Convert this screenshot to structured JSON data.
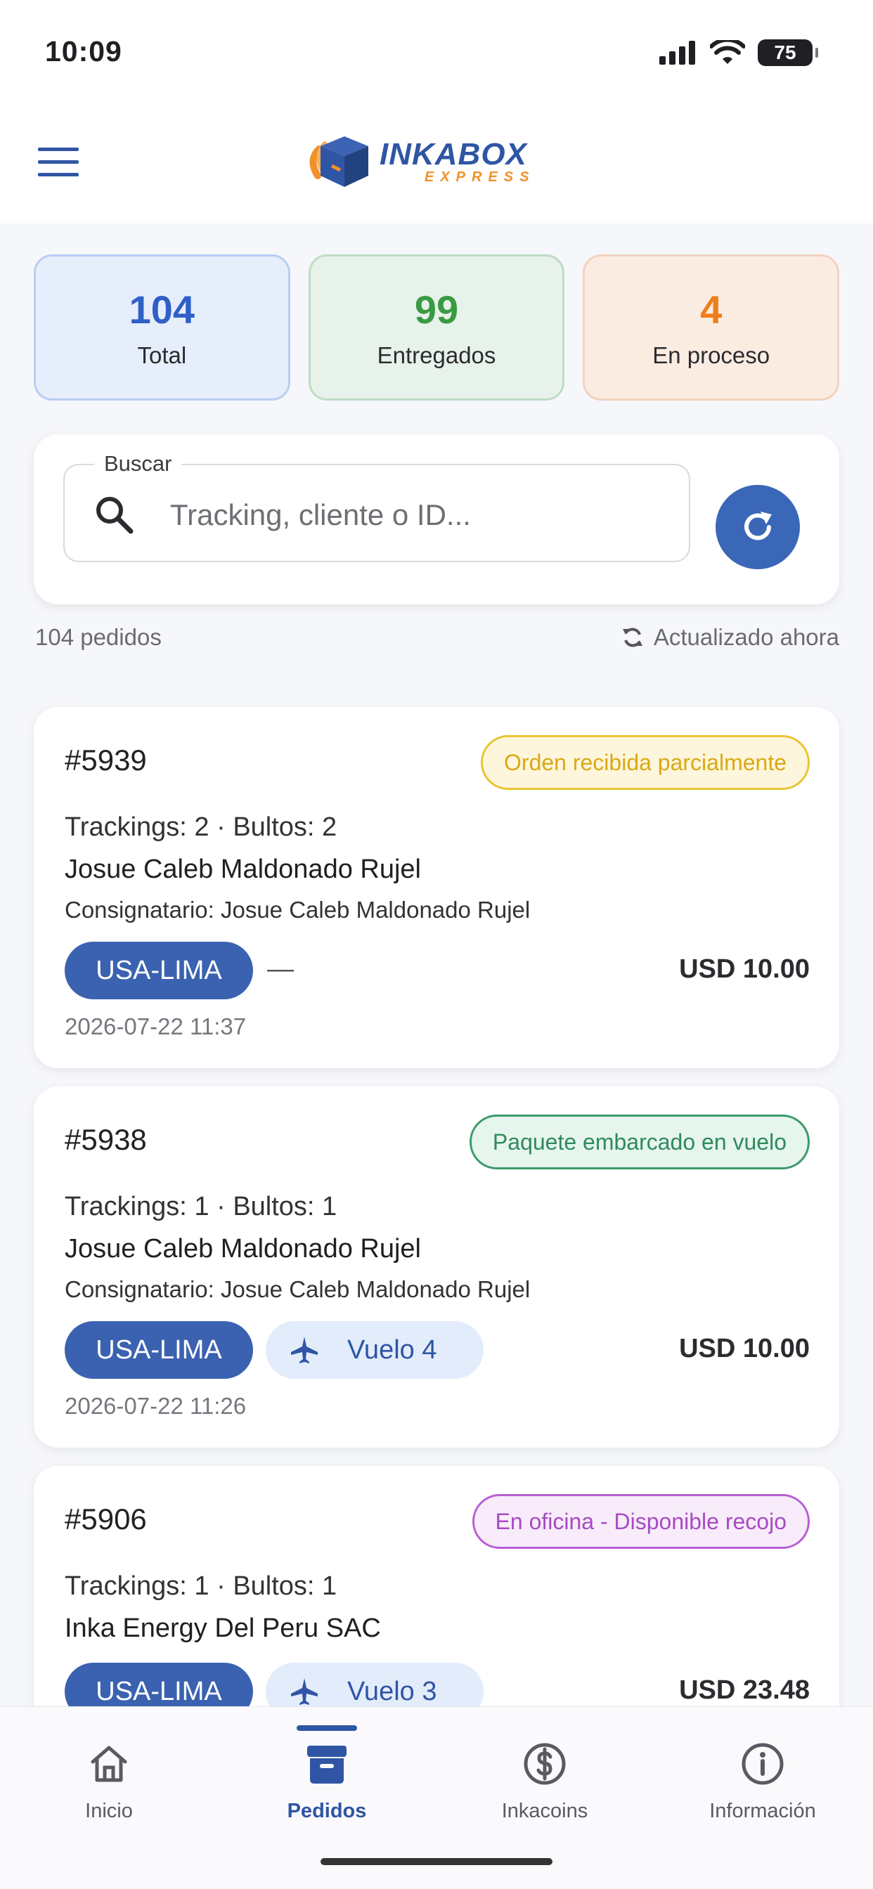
{
  "status_bar": {
    "time": "10:09",
    "battery": "75"
  },
  "header": {
    "logo_main": "INKABOX",
    "logo_sub": "EXPRESS"
  },
  "stats": [
    {
      "value": "104",
      "label": "Total"
    },
    {
      "value": "99",
      "label": "Entregados"
    },
    {
      "value": "4",
      "label": "En proceso"
    }
  ],
  "search": {
    "label": "Buscar",
    "placeholder": "Tracking, cliente o ID...",
    "value": ""
  },
  "meta": {
    "count": "104 pedidos",
    "updated": "Actualizado ahora"
  },
  "orders": [
    {
      "id": "#5939",
      "status": "Orden recibida parcialmente",
      "line1": "Trackings: 2 · Bultos: 2",
      "client": "Josue Caleb Maldonado Rujel",
      "consignee": "Consignatario: Josue Caleb Maldonado Rujel",
      "route": "USA-LIMA",
      "flight": "—",
      "amount": "USD 10.00",
      "date": "2026-07-22 11:37"
    },
    {
      "id": "#5938",
      "status": "Paquete embarcado en vuelo",
      "line1": "Trackings: 1 · Bultos: 1",
      "client": "Josue Caleb Maldonado Rujel",
      "consignee": "Consignatario: Josue Caleb Maldonado Rujel",
      "route": "USA-LIMA",
      "flight": "Vuelo 4",
      "amount": "USD 10.00",
      "date": "2026-07-22 11:26"
    },
    {
      "id": "#5906",
      "status": "En oficina - Disponible recojo",
      "line1": "Trackings: 1 · Bultos: 1",
      "client": "Inka Energy Del Peru SAC",
      "route": "USA-LIMA",
      "flight": "Vuelo 3",
      "amount": "USD 23.48"
    }
  ],
  "nav": [
    {
      "label": "Inicio",
      "icon": "home-icon"
    },
    {
      "label": "Pedidos",
      "icon": "archive-box-icon"
    },
    {
      "label": "Inkacoins",
      "icon": "dollar-coin-icon"
    },
    {
      "label": "Información",
      "icon": "info-icon"
    }
  ],
  "colors": {
    "brand_blue": "#2f55a4",
    "brand_orange": "#f0912c",
    "status_partial": "#e9c431",
    "status_flight": "#3a9a6a",
    "status_office": "#b95fd2"
  }
}
